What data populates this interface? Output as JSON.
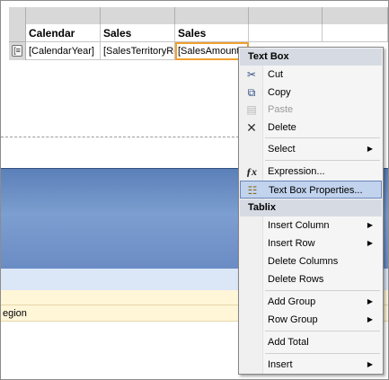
{
  "tablix": {
    "headers": [
      "Calendar",
      "Sales",
      "Sales Amount"
    ],
    "row": [
      "[CalendarYear]",
      "[SalesTerritoryRegion]",
      "[SalesAmount]"
    ],
    "group_glyph": "[≡"
  },
  "yellow_rows": [
    "egion"
  ],
  "menu": {
    "section1": "Text Box",
    "cut": "Cut",
    "copy": "Copy",
    "paste": "Paste",
    "delete": "Delete",
    "select": "Select",
    "expression": "Expression...",
    "textbox_props": "Text Box Properties...",
    "section2": "Tablix",
    "insert_column": "Insert Column",
    "insert_row": "Insert Row",
    "delete_columns": "Delete Columns",
    "delete_rows": "Delete Rows",
    "add_group": "Add Group",
    "row_group": "Row Group",
    "add_total": "Add Total",
    "insert": "Insert"
  },
  "icons": {
    "cut": "scissors-icon",
    "copy": "copy-icon",
    "paste": "paste-icon",
    "delete": "x-icon",
    "expression": "fx-icon",
    "properties": "properties-icon",
    "submenu": "submenu-arrow-icon"
  },
  "colors": {
    "selected_outline": "#f0a030",
    "menu_highlight": "#c2d3ee",
    "section_header": "#d6dbe3",
    "blue_band": "#6a8cc4"
  }
}
